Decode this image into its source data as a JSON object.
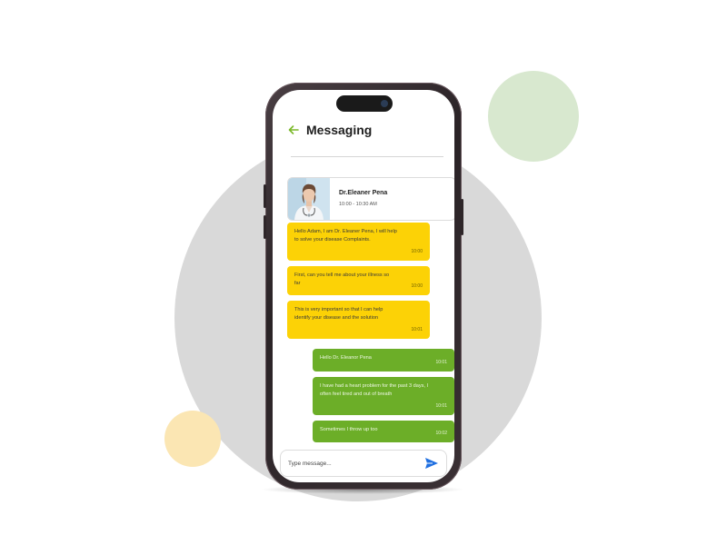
{
  "screen": {
    "title": "Messaging"
  },
  "doctor": {
    "name": "Dr.Eleaner Pena",
    "time_slot": "10:00 - 10:30 AM"
  },
  "messages": [
    {
      "side": "in",
      "text": "Hello Adam, I am Dr. Eleaner Pena, I will help to solve your disease Complaints.",
      "time": "10:00"
    },
    {
      "side": "in",
      "text": "First, can you tell me about your illness so far",
      "time": "10:00"
    },
    {
      "side": "in",
      "text": "This is very important so that I can help identify your disease and the solution",
      "time": "10:01"
    },
    {
      "side": "out",
      "text": "Hello Dr. Eleanor Pena",
      "time": "10:01"
    },
    {
      "side": "out",
      "text": "I have had a heart problem for the past 3 days, I often feel tired and out of breath",
      "time": "10:01"
    },
    {
      "side": "out",
      "text": "Sometimes I throw up too",
      "time": "10:02"
    }
  ],
  "composer": {
    "placeholder": "Type message..."
  },
  "icons": {
    "back": "arrow-left-icon",
    "send": "send-icon"
  },
  "colors": {
    "incoming_bubble": "#fcd206",
    "outgoing_bubble": "#6cae28",
    "accent": "#7ab829",
    "send": "#1f6fe0"
  }
}
